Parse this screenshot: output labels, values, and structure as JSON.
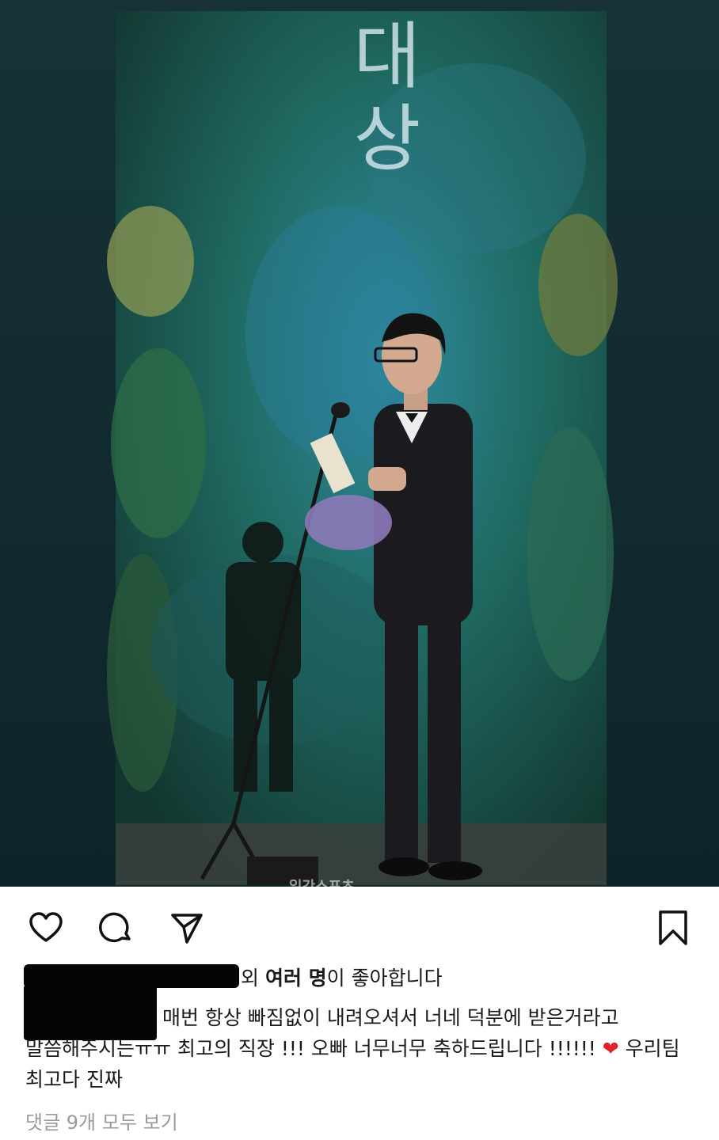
{
  "post": {
    "image": {
      "stage_text": "대\n상",
      "watermark": "일간스포츠"
    },
    "actions": {
      "like_icon": "heart-outline-icon",
      "comment_icon": "comment-bubble-icon",
      "share_icon": "paper-plane-icon",
      "save_icon": "bookmark-icon"
    },
    "likes": {
      "prefix": "외 ",
      "bold": "여러 명",
      "suffix": "이 좋아합니다"
    },
    "caption": {
      "line1": "매번 항상 빠짐없이 내려오셔서 너네 덕분에 받은거라고",
      "line2_a": "말씀해주시는ㅠㅠ 최고의 직장 !!! 오빠 너무너무 축하드립니다 !!!!!! ",
      "heart": "❤",
      "line2_b": " 우리팀",
      "line3": "최고다 진짜"
    },
    "view_comments": "댓글 9개 모두 보기",
    "colors": {
      "heart": "#e0202a",
      "muted": "#9a9a9a"
    }
  }
}
